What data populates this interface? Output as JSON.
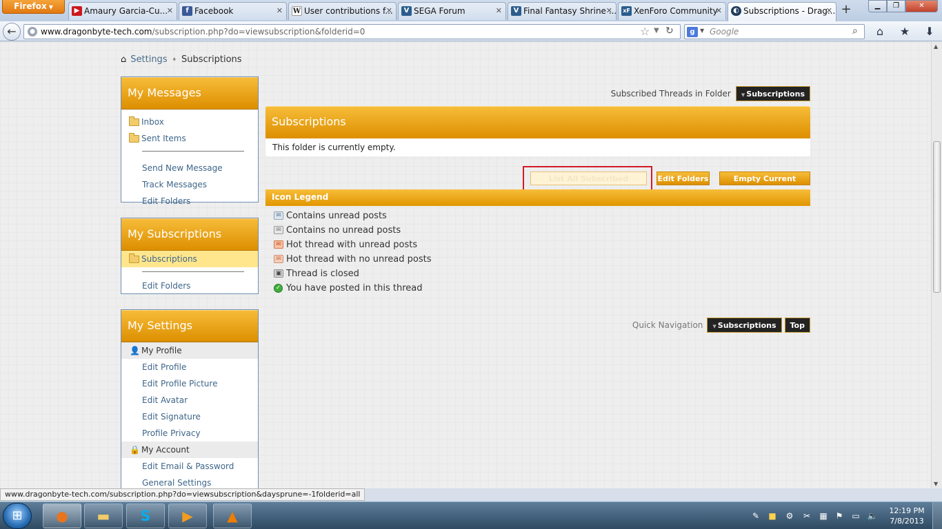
{
  "browser": {
    "menu_button": "Firefox",
    "tabs": [
      {
        "label": "Amaury Garcia-Cu...",
        "icon": "youtube-icon",
        "color": "#cc181e"
      },
      {
        "label": "Facebook",
        "icon": "facebook-icon",
        "color": "#3b5998"
      },
      {
        "label": "User contributions f...",
        "icon": "wikipedia-icon",
        "color": "#ffffff"
      },
      {
        "label": "SEGA Forum",
        "icon": "vbulletin-icon",
        "color": "#2b5d8c"
      },
      {
        "label": "Final Fantasy Shrine ...",
        "icon": "vbulletin-icon",
        "color": "#2b5d8c"
      },
      {
        "label": "XenForo Community",
        "icon": "xenforo-icon",
        "color": "#2b5d8c"
      },
      {
        "label": "Subscriptions - Drag...",
        "icon": "dragonbyte-icon",
        "color": "#1f3c5c"
      }
    ],
    "url_host": "www.dragonbyte-tech.com",
    "url_path": "/subscription.php?do=viewsubscription&folderid=0",
    "search_placeholder": "Google",
    "search_engine_letter": "g"
  },
  "breadcrumb": {
    "parent": "Settings",
    "current": "Subscriptions"
  },
  "sidebar": {
    "messages": {
      "title": "My Messages",
      "folders": [
        "Inbox",
        "Sent Items"
      ],
      "links": [
        "Send New Message",
        "Track Messages",
        "Edit Folders"
      ]
    },
    "subscriptions": {
      "title": "My Subscriptions",
      "folder": "Subscriptions",
      "links": [
        "Edit Folders"
      ]
    },
    "settings": {
      "title": "My Settings",
      "profile_head": "My Profile",
      "profile_links": [
        "Edit Profile",
        "Edit Profile Picture",
        "Edit Avatar",
        "Edit Signature",
        "Profile Privacy"
      ],
      "account_head": "My Account",
      "account_links": [
        "Edit Email & Password",
        "General Settings"
      ]
    }
  },
  "main": {
    "folder_label": "Subscribed Threads in Folder",
    "folder_select": "Subscriptions",
    "block_title": "Subscriptions",
    "empty_message": "This folder is currently empty.",
    "buttons": {
      "list_all": "List All Subscribed Threads",
      "edit_folders": "Edit Folders",
      "empty_folder": "Empty Current Folder"
    },
    "legend_title": "Icon Legend",
    "legend": [
      {
        "label": "Contains unread posts",
        "icon": "unread-posts-icon"
      },
      {
        "label": "Contains no unread posts",
        "icon": "no-unread-posts-icon"
      },
      {
        "label": "Hot thread with unread posts",
        "icon": "hot-unread-icon"
      },
      {
        "label": "Hot thread with no unread posts",
        "icon": "hot-no-unread-icon"
      },
      {
        "label": "Thread is closed",
        "icon": "lock-icon"
      },
      {
        "label": "You have posted in this thread",
        "icon": "posted-checkmark-icon"
      }
    ],
    "quick_nav_label": "Quick Navigation",
    "quick_nav_select": "Subscriptions",
    "top_button": "Top"
  },
  "status_url": "www.dragonbyte-tech.com/subscription.php?do=viewsubscription&daysprune=-1folderid=all",
  "taskbar": {
    "time": "12:19 PM",
    "date": "7/8/2013"
  },
  "colors": {
    "accent_orange": "#f0a818",
    "link_blue": "#3e6589",
    "highlight_red": "#d21a28"
  }
}
